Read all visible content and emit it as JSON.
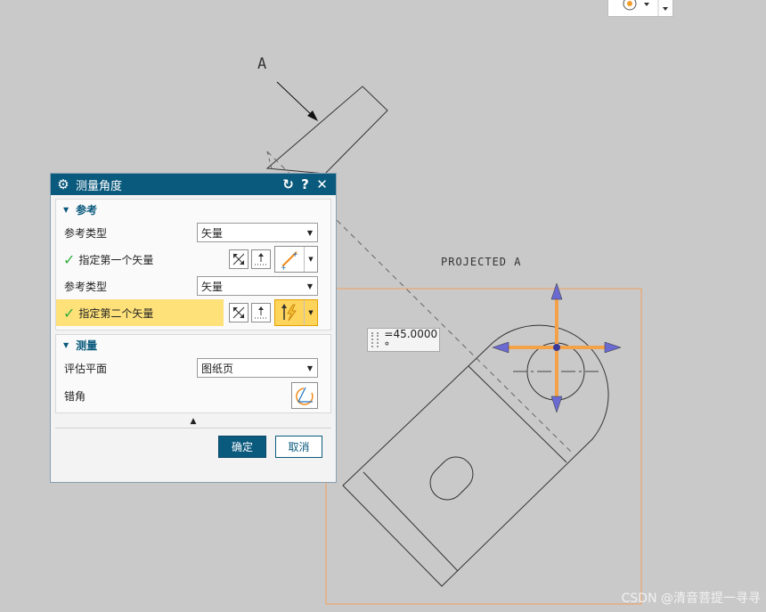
{
  "drawing": {
    "view_label": "A",
    "projected_label": "PROJECTED A",
    "angle_value": "=45.0000 °"
  },
  "watermark": "CSDN @清音菩提一寻寻",
  "dialog": {
    "title": "测量角度",
    "reference_section": {
      "header": "参考",
      "rows": [
        {
          "label": "参考类型",
          "value": "矢量"
        },
        {
          "label": "指定第一个矢量"
        },
        {
          "label": "参考类型",
          "value": "矢量"
        },
        {
          "label": "指定第二个矢量"
        }
      ]
    },
    "measure_section": {
      "header": "测量",
      "eval_plane_label": "评估平面",
      "eval_plane_value": "图纸页",
      "bevel_label": "错角"
    },
    "ok_label": "确定",
    "cancel_label": "取消"
  },
  "colors": {
    "title_bar": "#0a5a7d",
    "highlight": "#ffe17a",
    "check": "#2cae3c",
    "manipulator": "#f4a24a",
    "view_border": "#f29e5a"
  }
}
